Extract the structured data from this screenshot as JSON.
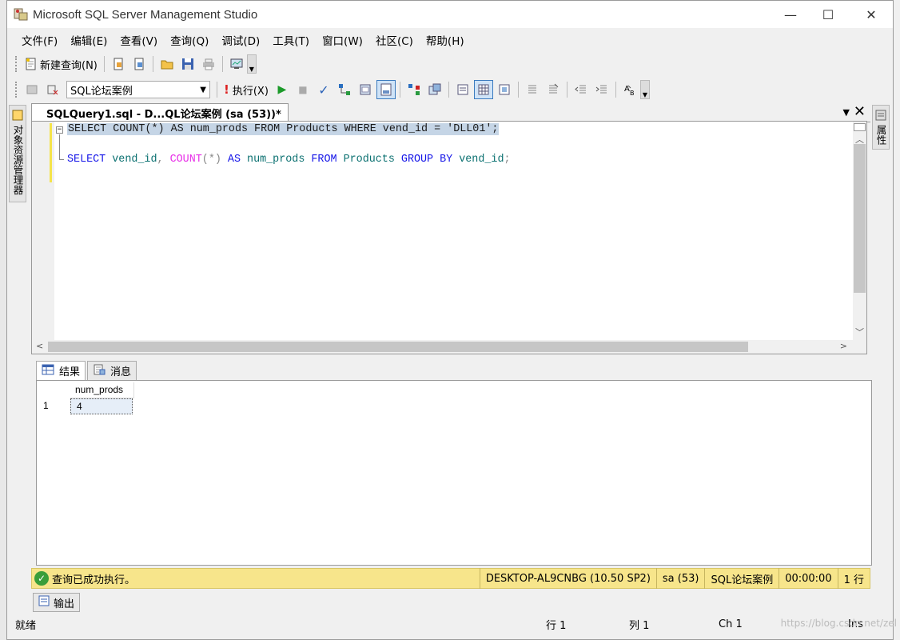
{
  "window": {
    "title": "Microsoft SQL Server Management Studio",
    "minimize": "—",
    "maximize": "☐",
    "close": "✕"
  },
  "menu": [
    "文件(F)",
    "编辑(E)",
    "查看(V)",
    "查询(Q)",
    "调试(D)",
    "工具(T)",
    "窗口(W)",
    "社区(C)",
    "帮助(H)"
  ],
  "toolbar1": {
    "new_query": "新建查询(N)"
  },
  "toolbar2": {
    "database": "SQL论坛案例",
    "execute": "执行(X)"
  },
  "side_left": "对象资源管理器",
  "side_right": "属性",
  "document_tab": {
    "label": "SQLQuery1.sql - D...QL论坛案例 (sa (53))*"
  },
  "editor": {
    "line1": {
      "t1": "SELECT",
      "t2": " COUNT",
      "t3": "(*)",
      "t4": " AS",
      "t5": " num_prods",
      "t6": " FROM",
      "t7": " Products",
      "t8": " WHERE",
      "t9": " vend_id",
      "t10": " =",
      "t11": " 'DLL01'",
      "t12": ";"
    },
    "line2": {
      "t1": "SELECT",
      "t2": " vend_id",
      "t3": ",",
      "t4": " COUNT",
      "t5": "(*)",
      "t6": " AS",
      "t7": " num_prods",
      "t8": " FROM",
      "t9": " Products",
      "t10": " GROUP",
      "t11": " BY",
      "t12": " vend_id",
      "t13": ";"
    }
  },
  "results_tabs": {
    "results": "结果",
    "messages": "消息"
  },
  "results_grid": {
    "columns": [
      "num_prods"
    ],
    "rows": [
      {
        "row_num": "1",
        "values": [
          "4"
        ]
      }
    ]
  },
  "query_status": {
    "message": "查询已成功执行。",
    "server": "DESKTOP-AL9CNBG (10.50 SP2)",
    "user": "sa (53)",
    "database": "SQL论坛案例",
    "elapsed": "00:00:00",
    "rows": "1 行"
  },
  "output_tab": "输出",
  "statusbar": {
    "ready": "就绪",
    "line": "行 1",
    "col": "列 1",
    "ch": "Ch 1",
    "mode": "Ins"
  },
  "watermark": "https://blog.csdn.net/zel"
}
